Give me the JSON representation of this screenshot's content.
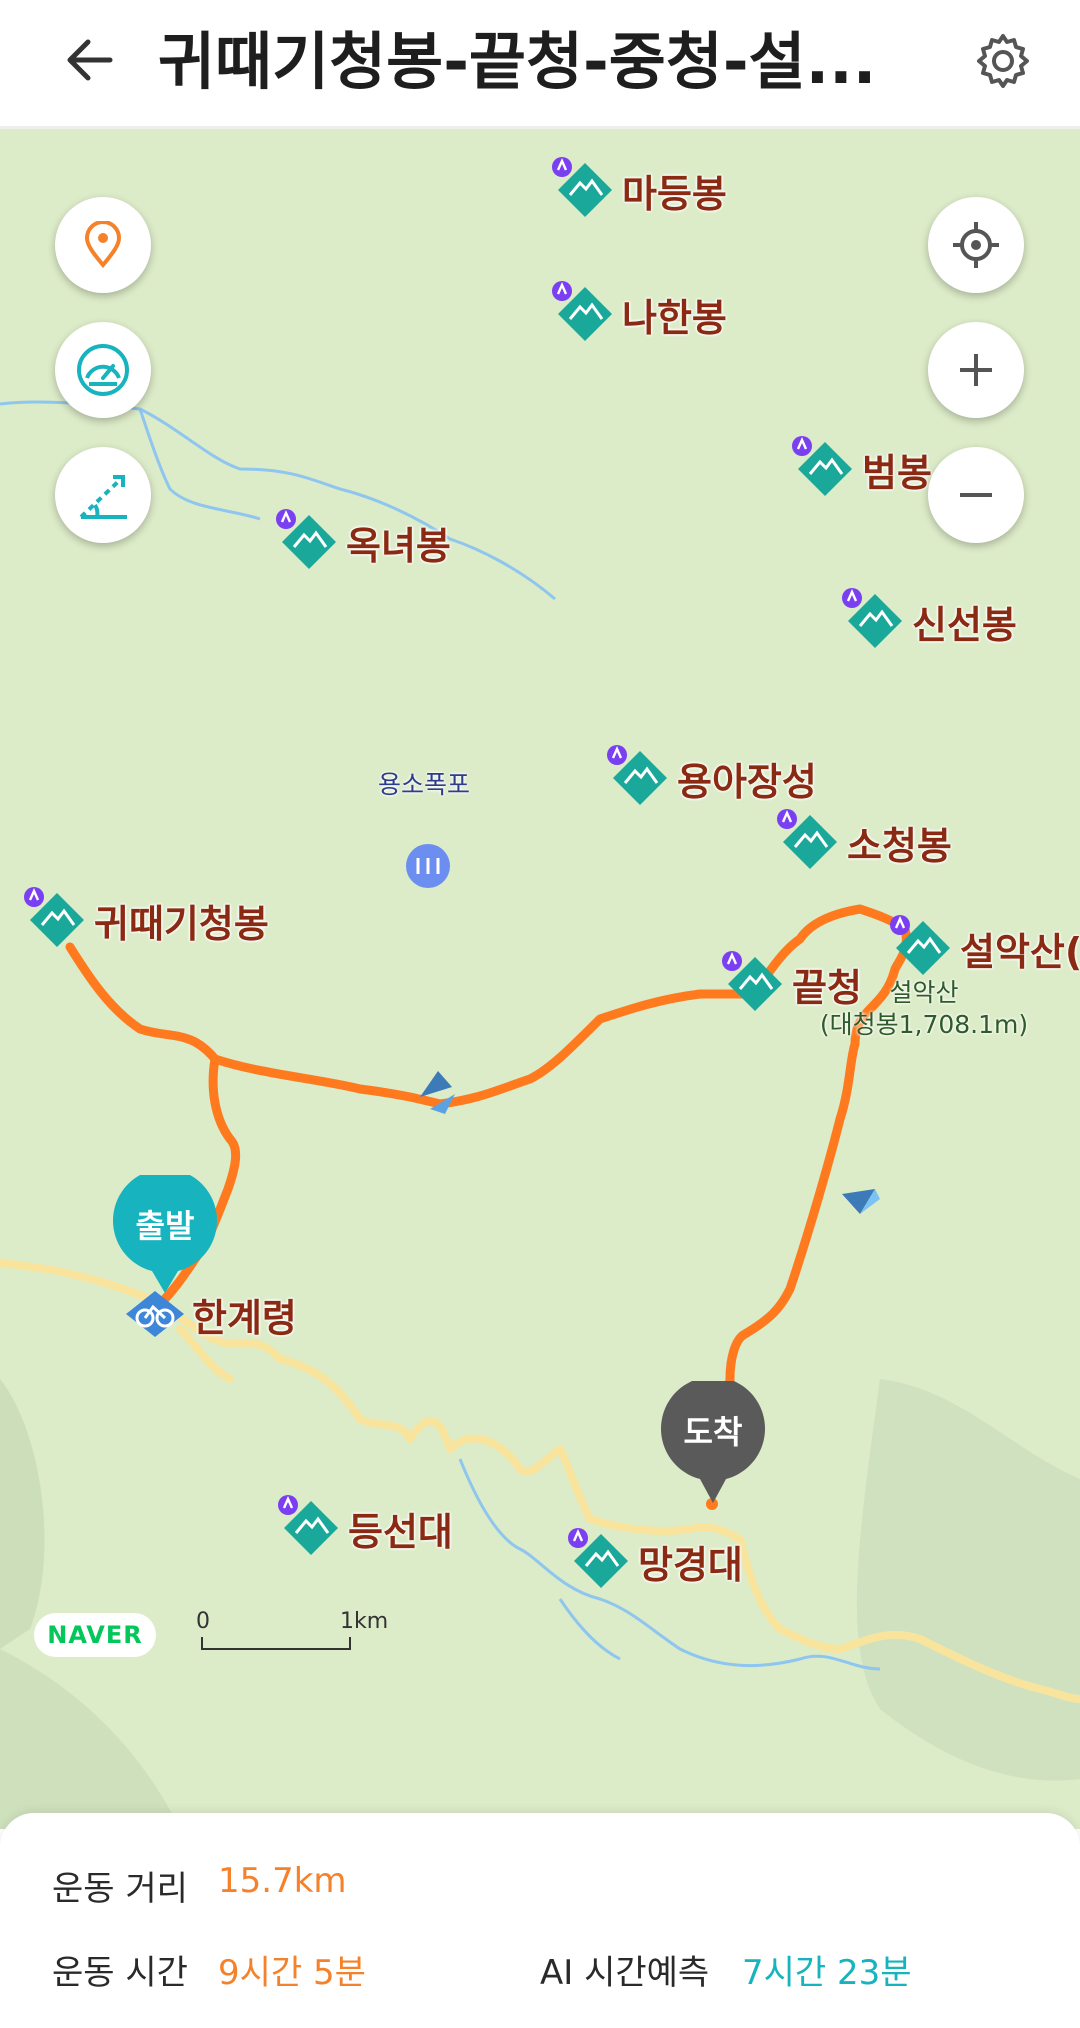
{
  "header": {
    "title": "귀때기청봉-끝청-중청-설...",
    "back_icon": "back-arrow-icon",
    "settings_icon": "gear-icon"
  },
  "map_controls": {
    "left": [
      "location-pin-icon",
      "speedometer-icon",
      "slope-icon"
    ],
    "right": [
      "my-location-icon",
      "zoom-in-icon",
      "zoom-out-icon"
    ]
  },
  "peaks": [
    {
      "name": "마등봉"
    },
    {
      "name": "나한봉"
    },
    {
      "name": "범봉"
    },
    {
      "name": "옥녀봉"
    },
    {
      "name": "신선봉"
    },
    {
      "name": "용아장성"
    },
    {
      "name": "소청봉"
    },
    {
      "name": "귀때기청봉"
    },
    {
      "name": "끝청"
    },
    {
      "name": "설악산("
    },
    {
      "name": "등선대"
    },
    {
      "name": "망경대"
    }
  ],
  "poi": {
    "waterfall": "용소폭포"
  },
  "summit": {
    "line1": "설악산",
    "line2": "(대청봉1,708.1m)"
  },
  "start": {
    "pin": "출발",
    "name": "한계령"
  },
  "end": {
    "pin": "도착"
  },
  "attribution": {
    "brand": "NAVER"
  },
  "scale": {
    "zero": "0",
    "distance": "1km"
  },
  "stats": {
    "distance_label": "운동 거리",
    "distance_value": "15.7km",
    "time_label": "운동 시간",
    "time_value": "9시간 5분",
    "ai_label": "AI 시간예측",
    "ai_value": "7시간 23분"
  },
  "colors": {
    "route": "#ff7a1f",
    "accent_orange": "#f5822a",
    "accent_teal": "#17b3be",
    "peak_icon": "#1aa89a",
    "road": "#f9e49e",
    "stream": "#8ec6ef"
  }
}
